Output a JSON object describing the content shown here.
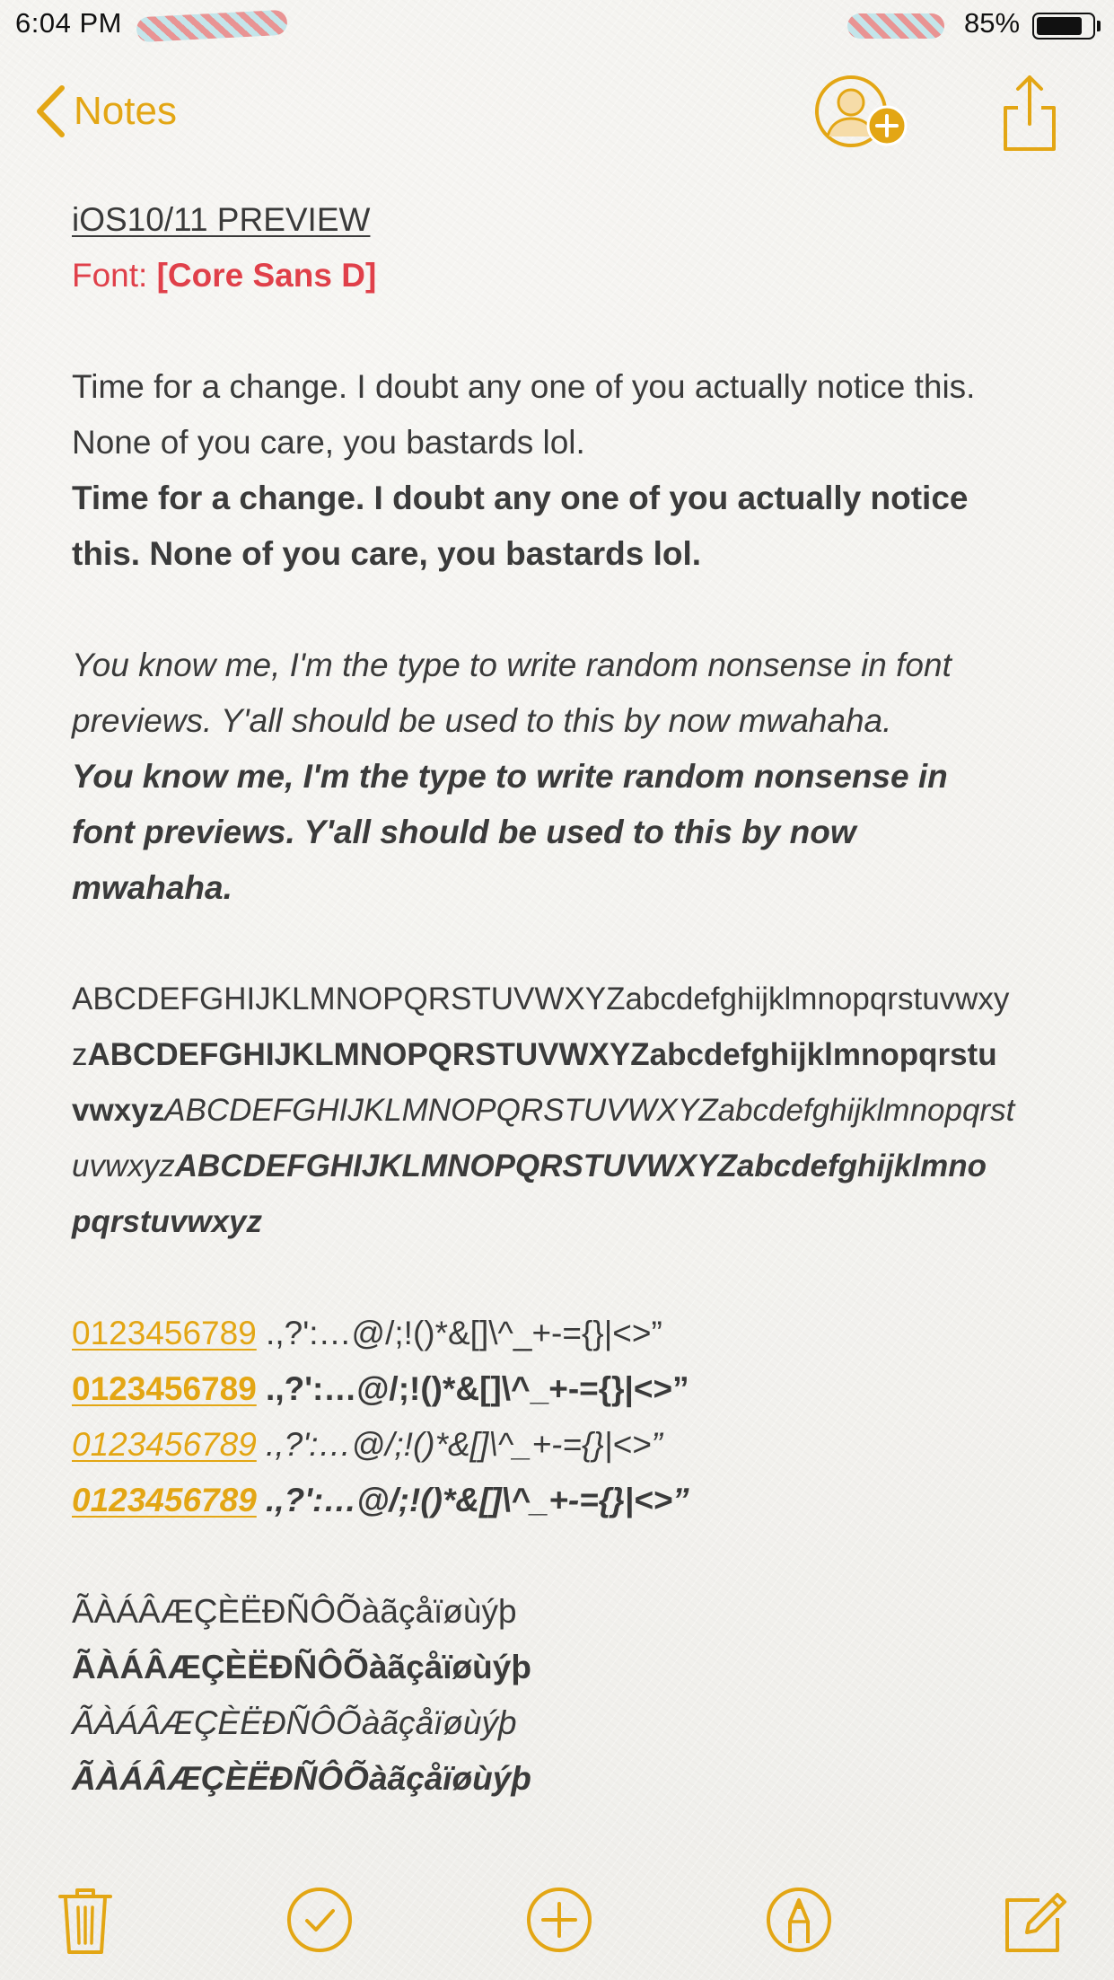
{
  "status_bar": {
    "time": "6:04 PM",
    "battery_percent": "85%",
    "battery_level": 0.85
  },
  "nav": {
    "back_label": "Notes",
    "accent_color": "#e3a614"
  },
  "note": {
    "title": "iOS10/11 PREVIEW",
    "font_prefix": "Font: ",
    "font_name": "[Core Sans D]",
    "font_line_color": "#e0404a",
    "regular": [
      "Time for a change. I doubt any one of you actually notice this.",
      "None of you care, you bastards lol."
    ],
    "bold": [
      "Time for a change. I doubt any one of you actually notice",
      "this. None of you care, you bastards lol."
    ],
    "italic": [
      "You know me, I'm the type to write random nonsense in font",
      "previews. Y'all should be used to this by now mwahaha."
    ],
    "bold_italic": [
      "You know me, I'm the type to write random nonsense in",
      "font previews. Y'all should be used to this by now",
      "mwahaha."
    ],
    "alphabet": {
      "line1_regular": "ABCDEFGHIJKLMNOPQRSTUVWXYZabcdefghijklmnopqrstuvwxy",
      "line2_regular": "z",
      "line2_bold": "ABCDEFGHIJKLMNOPQRSTUVWXYZabcdefghijklmnopqrstu",
      "line3_bold": "vwxyz",
      "line3_italic": "ABCDEFGHIJKLMNOPQRSTUVWXYZabcdefghijklmnopqrst",
      "line4_italic": "uvwxyz",
      "line4_bold_italic": "ABCDEFGHIJKLMNOPQRSTUVWXYZabcdefghijklmno",
      "line5_bold_italic": "pqrstuvwxyz"
    },
    "numbers": {
      "digits": "0123456789",
      "symbols": " .,?':…@/;!()*&[]\\^_+-={}|<>”"
    },
    "accents": "ÃÀÁÂÆÇÈËÐÑÔÕàãçåïøùýþ"
  },
  "toolbar": {
    "icons": [
      "trash-icon",
      "checklist-icon",
      "add-icon",
      "sketch-icon",
      "compose-icon"
    ]
  }
}
